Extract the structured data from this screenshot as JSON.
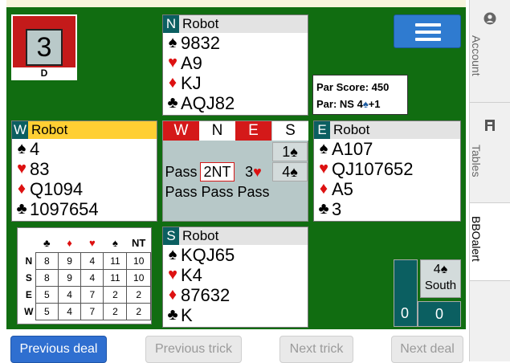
{
  "board": {
    "number": "3",
    "dealer": "D"
  },
  "par": {
    "score_label": "Par Score: 450",
    "contract_prefix": "Par: NS 4",
    "contract_suffix": "+1"
  },
  "hands": {
    "north": {
      "seat": "N",
      "player": "Robot",
      "spades": "9832",
      "hearts": "A9",
      "diamonds": "KJ",
      "clubs": "AQJ82"
    },
    "west": {
      "seat": "W",
      "player": "Robot",
      "spades": "4",
      "hearts": "83",
      "diamonds": "Q1094",
      "clubs": "1097654"
    },
    "east": {
      "seat": "E",
      "player": "Robot",
      "spades": "A107",
      "hearts": "QJ107652",
      "diamonds": "A5",
      "clubs": "3"
    },
    "south": {
      "seat": "S",
      "player": "Robot",
      "spades": "KQJ65",
      "hearts": "K4",
      "diamonds": "87632",
      "clubs": "K"
    }
  },
  "auction": {
    "headers": [
      "W",
      "N",
      "E",
      "S"
    ],
    "row1": {
      "s": "1"
    },
    "row2": {
      "w": "Pass",
      "n": "2NT",
      "e": "3",
      "s": "4"
    },
    "row3": {
      "w": "Pass",
      "n": "Pass",
      "e": "Pass"
    }
  },
  "scores": {
    "suits": [
      "♣",
      "♦",
      "♥",
      "♠",
      "NT"
    ],
    "rows": [
      {
        "label": "N",
        "values": [
          "8",
          "9",
          "4",
          "11",
          "10"
        ]
      },
      {
        "label": "S",
        "values": [
          "8",
          "9",
          "4",
          "11",
          "10"
        ]
      },
      {
        "label": "E",
        "values": [
          "5",
          "4",
          "7",
          "2",
          "2"
        ]
      },
      {
        "label": "W",
        "values": [
          "5",
          "4",
          "7",
          "2",
          "2"
        ]
      }
    ]
  },
  "contract": {
    "level": "4",
    "declarer": "South"
  },
  "tricks": {
    "ns": "0",
    "ew": "0"
  },
  "buttons": {
    "prev_deal": "Previous deal",
    "prev_trick": "Previous trick",
    "next_trick": "Next trick",
    "next_deal": "Next deal"
  },
  "sidebar": {
    "tabs": [
      "Account",
      "Tables",
      "BBOalert"
    ]
  },
  "colors": {
    "felt": "#116d11",
    "vulnerable": "#d41919",
    "seat_badge": "#0b5f61",
    "primary_button": "#2f6fd0"
  },
  "icons": {
    "spade": "♠",
    "heart": "♥",
    "diamond": "♦",
    "club": "♣",
    "menu": "hamburger-icon",
    "account": "account-icon",
    "tables": "tables-icon"
  }
}
